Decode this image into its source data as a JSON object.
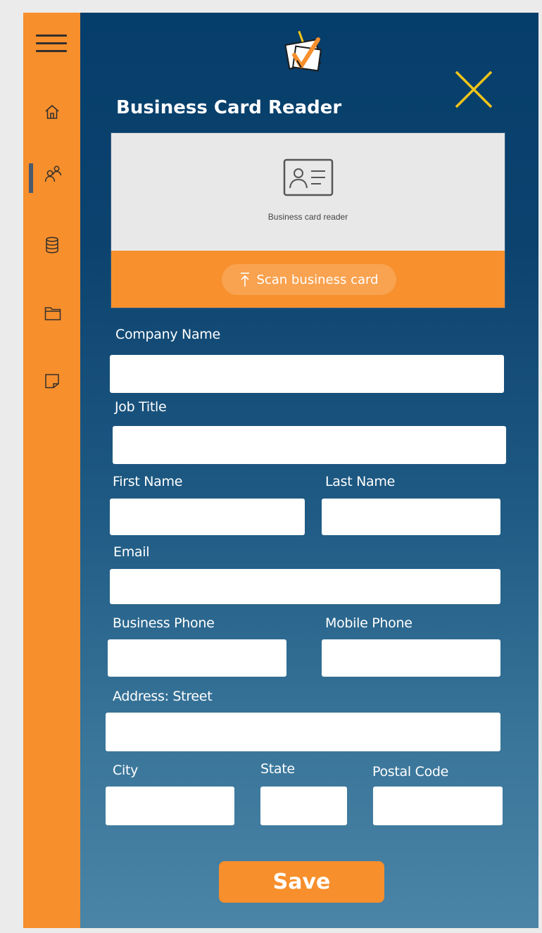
{
  "app": {
    "title": "Business Card Reader"
  },
  "colors": {
    "sidebar": "#f78f2c",
    "main_top": "#063e6b",
    "main_bottom": "#4a84a6",
    "accent_yellow": "#f5c518",
    "save_button": "#f78f2c"
  },
  "sidebar": {
    "menu_icon": "hamburger-icon",
    "items": [
      {
        "icon": "home-icon",
        "active": false
      },
      {
        "icon": "contacts-icon",
        "active": true
      },
      {
        "icon": "database-icon",
        "active": false
      },
      {
        "icon": "folder-icon",
        "active": false
      },
      {
        "icon": "note-icon",
        "active": false
      }
    ]
  },
  "card_reader": {
    "icon": "contact-card-icon",
    "caption": "Business card reader",
    "scan_icon": "upload-arrow-icon",
    "scan_label": "Scan business card"
  },
  "form": {
    "company_name": {
      "label": "Company Name",
      "value": ""
    },
    "job_title": {
      "label": "Job Title",
      "value": ""
    },
    "first_name": {
      "label": "First Name",
      "value": ""
    },
    "last_name": {
      "label": "Last Name",
      "value": ""
    },
    "email": {
      "label": "Email",
      "value": ""
    },
    "business_phone": {
      "label": "Business Phone",
      "value": ""
    },
    "mobile_phone": {
      "label": "Mobile Phone",
      "value": ""
    },
    "address_street": {
      "label": "Address: Street",
      "value": ""
    },
    "city": {
      "label": "City",
      "value": ""
    },
    "state": {
      "label": "State",
      "value": ""
    },
    "postal_code": {
      "label": "Postal Code",
      "value": ""
    }
  },
  "save_label": "Save"
}
